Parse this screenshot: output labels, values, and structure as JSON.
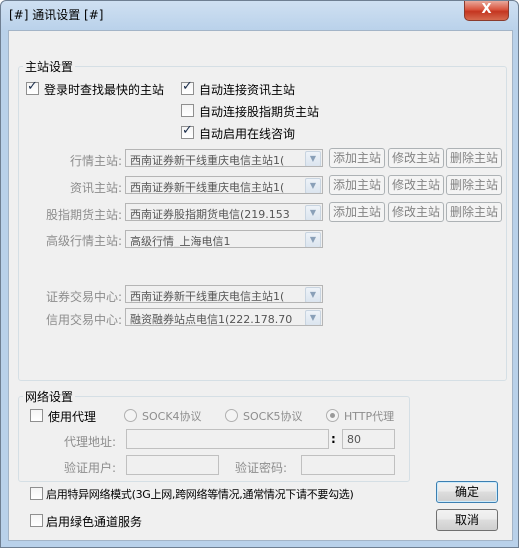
{
  "window": {
    "title": "[#] 通讯设置 [#]",
    "close_label": "X"
  },
  "main_station": {
    "legend": "主站设置",
    "options": {
      "find_fastest": {
        "label": "登录时查找最快的主站",
        "checked": true
      },
      "auto_info": {
        "label": "自动连接资讯主站",
        "checked": true
      },
      "auto_futures": {
        "label": "自动连接股指期货主站",
        "checked": false
      },
      "auto_consult": {
        "label": "自动启用在线咨询",
        "checked": true
      }
    },
    "rows": [
      {
        "label": "行情主站:",
        "value": "西南证券新干线重庆电信主站1(",
        "add": "添加主站",
        "edit": "修改主站",
        "delete": "删除主站"
      },
      {
        "label": "资讯主站:",
        "value": "西南证券新干线重庆电信主站1(",
        "add": "添加主站",
        "edit": "修改主站",
        "delete": "删除主站"
      },
      {
        "label": "股指期货主站:",
        "value": "西南证券股指期货电信(219.153",
        "add": "添加主站",
        "edit": "修改主站",
        "delete": "删除主站"
      },
      {
        "label": "高级行情主站:",
        "value": "高级行情_上海电信1"
      }
    ],
    "trade_rows": [
      {
        "label": "证券交易中心:",
        "value": "西南证券新干线重庆电信主站1("
      },
      {
        "label": "信用交易中心:",
        "value": "融资融券站点电信1(222.178.70"
      }
    ]
  },
  "network": {
    "legend": "网络设置",
    "use_proxy": {
      "label": "使用代理",
      "checked": false
    },
    "protocols": [
      {
        "label": "SOCK4协议",
        "selected": false
      },
      {
        "label": "SOCK5协议",
        "selected": false
      },
      {
        "label": "HTTP代理",
        "selected": true
      }
    ],
    "proxy_address_label": "代理地址:",
    "proxy_address_value": "",
    "port_separator": ":",
    "port_value": "80",
    "verify_user_label": "验证用户:",
    "verify_user_value": "",
    "verify_password_label": "验证密码:",
    "verify_password_value": ""
  },
  "bottom_options": {
    "special_mode": {
      "label": "启用特异网络模式(3G上网,跨网络等情况,通常情况下请不要勾选)",
      "checked": false
    },
    "green_channel": {
      "label": "启用绿色通道服务",
      "checked": false
    }
  },
  "buttons": {
    "ok": "确定",
    "cancel": "取消"
  },
  "icons": {
    "checkbox": "check-icon",
    "dropdown": "chevron-down-icon",
    "close": "close-icon"
  }
}
